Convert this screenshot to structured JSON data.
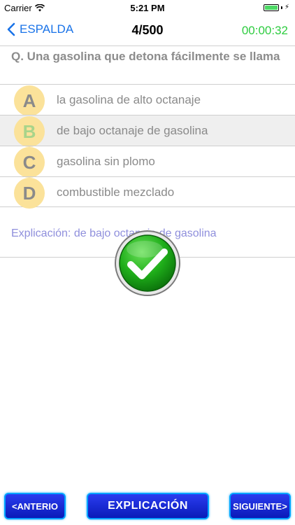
{
  "status_bar": {
    "carrier": "Carrier",
    "time": "5:21 PM",
    "battery_color": "#4cd964"
  },
  "nav": {
    "back_label": "ESPALDA",
    "counter": "4/500",
    "timer": "00:00:32",
    "accent_color": "#1a73e8",
    "timer_color": "#2ecc40"
  },
  "question": {
    "text": "Q. Una gasolina que detona fácilmente se llama"
  },
  "options": [
    {
      "letter": "A",
      "text": "la gasolina de alto octanaje",
      "selected": false
    },
    {
      "letter": "B",
      "text": "de bajo octanaje de gasolina",
      "selected": true
    },
    {
      "letter": "C",
      "text": "gasolina sin plomo",
      "selected": false
    },
    {
      "letter": "D",
      "text": "combustible mezclado",
      "selected": false
    }
  ],
  "explanation": {
    "text": "Explicación: de bajo octanaje de gasolina"
  },
  "result_icon": "check-icon",
  "buttons": {
    "prev_label": "<ANTERIO",
    "explain_label": "EXPLICACIÓN",
    "next_label": "SIGUIENTE>"
  }
}
